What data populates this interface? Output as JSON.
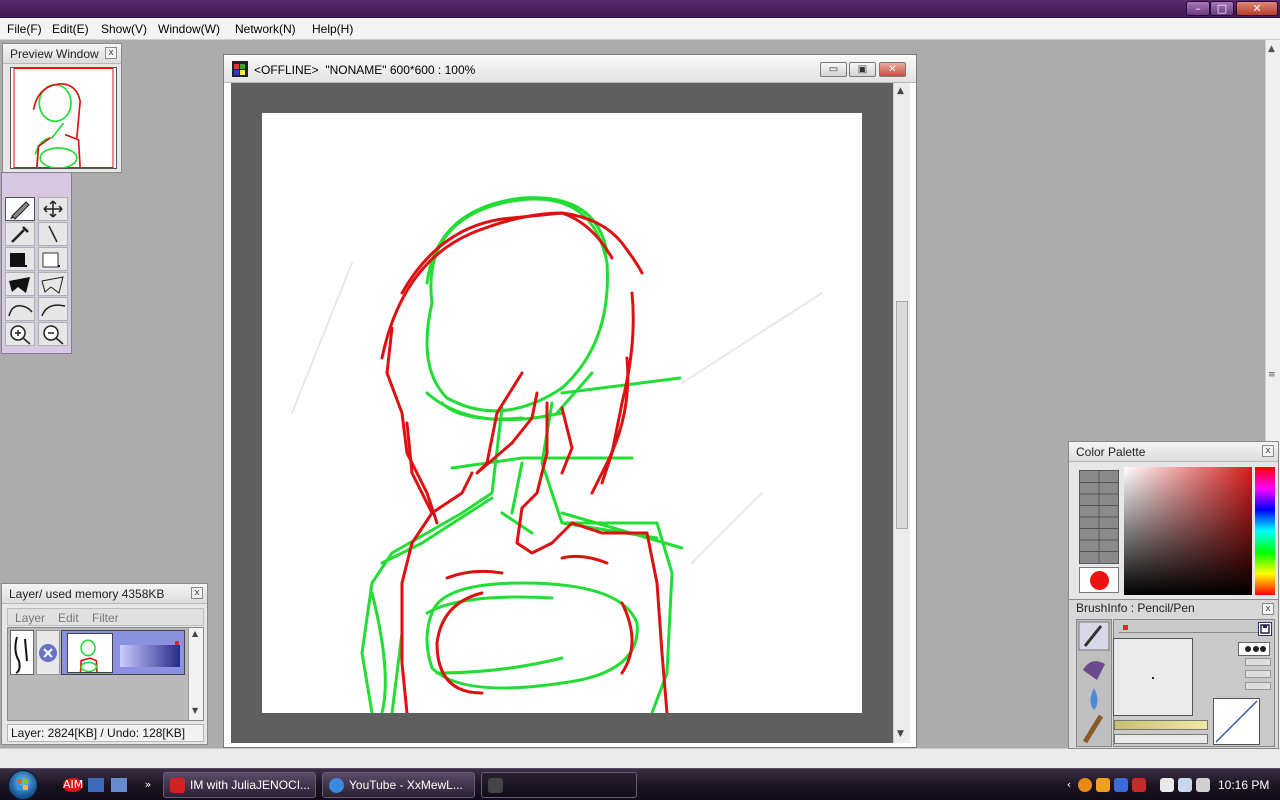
{
  "window_controls": {
    "minimize": "–",
    "maximize": "□",
    "close": "✕"
  },
  "menu": [
    "File(F)",
    "Edit(E)",
    "Show(V)",
    "Window(W)",
    "Network(N)",
    "Help(H)"
  ],
  "preview_window": {
    "title": "Preview Window",
    "close": "x"
  },
  "canvas": {
    "title": "<OFFLINE>  \"NONAME\" 600*600 : 100%",
    "min": "▭",
    "max": "▣",
    "close": "✕",
    "scroll_up": "▲",
    "scroll_down": "▼",
    "line_colors": {
      "green": "#22dd33",
      "red": "#dd1111"
    }
  },
  "tools": [
    {
      "name": "pen-icon",
      "glyph": "✎"
    },
    {
      "name": "move-icon",
      "glyph": "✥"
    },
    {
      "name": "eyedropper-icon",
      "glyph": "⌁"
    },
    {
      "name": "line-icon",
      "glyph": "╲"
    },
    {
      "name": "fill-black-icon",
      "glyph": ""
    },
    {
      "name": "fill-white-icon",
      "glyph": ""
    },
    {
      "name": "lasso-fill-icon",
      "glyph": ""
    },
    {
      "name": "lasso-icon",
      "glyph": ""
    },
    {
      "name": "curve-icon",
      "glyph": ""
    },
    {
      "name": "curve-alt-icon",
      "glyph": ""
    },
    {
      "name": "zoom-in-icon",
      "glyph": "⊕"
    },
    {
      "name": "zoom-out-icon",
      "glyph": "⊖"
    }
  ],
  "layer_panel": {
    "title": "Layer/ used memory 4358KB",
    "close": "x",
    "menu": [
      "Layer",
      "Edit",
      "Filter"
    ],
    "status": "Layer: 2824[KB] / Undo: 128[KB]"
  },
  "color_palette": {
    "title": "Color Palette",
    "close": "x",
    "current_color": "#ee1111"
  },
  "brush_info": {
    "title": "BrushInfo :  Pencil/Pen",
    "close": "x"
  },
  "taskbar": {
    "tasks": [
      {
        "label": "IM with JuliaJENOCI...",
        "color": "#d32020"
      },
      {
        "label": "YouTube - XxMewL...",
        "color": "#3a8ae0"
      },
      {
        "label": "",
        "color": "#444"
      }
    ],
    "quick_launch": [
      "AIM",
      "desktop",
      "window",
      "more"
    ],
    "clock": "10:16 PM"
  }
}
